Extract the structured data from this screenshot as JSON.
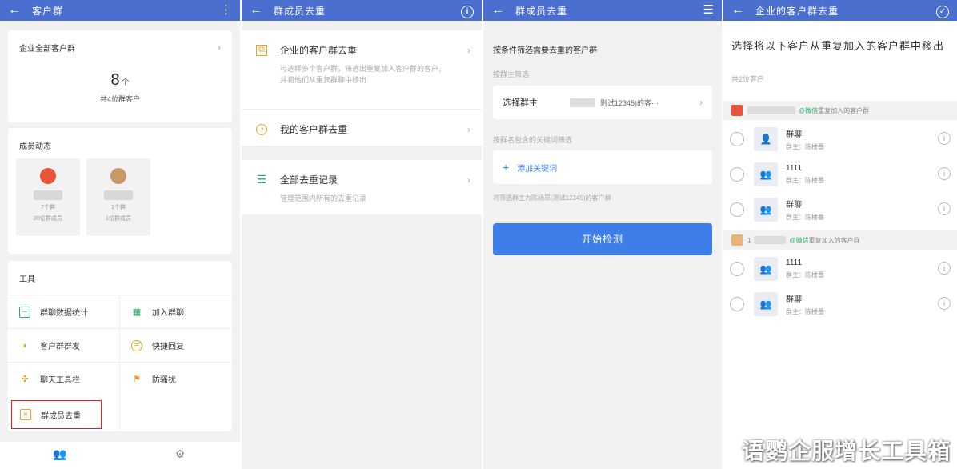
{
  "panel1": {
    "title": "客户群",
    "menu_icon": "more-vertical-icon",
    "all_groups": {
      "label": "企业全部客户群",
      "count": "8",
      "unit": "个",
      "subtitle": "共4位群客户"
    },
    "members": {
      "title": "成员动态",
      "items": [
        {
          "line1": "7个群",
          "line2": "20位群成员"
        },
        {
          "line1": "1个群",
          "line2": "1位群成员"
        }
      ]
    },
    "tools": {
      "title": "工具",
      "items": [
        {
          "label": "群聊数据统计",
          "icon": "chart-icon",
          "color": "#2aae67"
        },
        {
          "label": "加入群聊",
          "icon": "qrcode-icon",
          "color": "#2aae67"
        },
        {
          "label": "客户群群发",
          "icon": "broadcast-icon",
          "color": "#f0a020"
        },
        {
          "label": "快捷回复",
          "icon": "chat-icon",
          "color": "#f0a020"
        },
        {
          "label": "聊天工具栏",
          "icon": "toolbar-icon",
          "color": "#f0a020"
        },
        {
          "label": "防骚扰",
          "icon": "flag-icon",
          "color": "#f0a020"
        },
        {
          "label": "群成员去重",
          "icon": "dedupe-icon",
          "color": "#f0a020"
        }
      ]
    }
  },
  "panel2": {
    "title": "群成员去重",
    "entries": [
      {
        "title": "企业的客户群去重",
        "desc": "可选择多个客户群，筛选出重复加入客户群的客户，并将他们从重复群聊中移出",
        "icon": "group-dedupe-icon",
        "color": "#f0a020"
      },
      {
        "title": "我的客户群去重",
        "desc": "",
        "icon": "my-group-icon",
        "color": "#f0a020"
      },
      {
        "title": "全部去重记录",
        "desc": "管理范围内所有的去重记录",
        "icon": "list-icon",
        "color": "#2aae67"
      }
    ]
  },
  "panel3": {
    "title": "群成员去重",
    "heading": "按条件筛选需要去重的客户群",
    "owner_filter_label": "按群主筛选",
    "owner_select_label": "选择群主",
    "owner_select_value": "则试12345)的客···",
    "keyword_filter_label": "按群名包含的关键词筛选",
    "add_keyword": "添加关键词",
    "hint": "将筛选群主为陈杨昂(测试12345)的客户群",
    "start_button": "开始检测"
  },
  "panel4": {
    "title": "企业的客户群去重",
    "headline": "选择将以下客户从重复加入的客户群中移出",
    "count": "共2位客户",
    "groups": [
      {
        "wechat": "@微信",
        "desc": "重复加入的客户群",
        "rows": [
          {
            "name": "群聊",
            "owner": "群主：陈楼番"
          },
          {
            "name": "1111",
            "owner": "群主：陈楼番"
          },
          {
            "name": "群聊",
            "owner": "群主：陈楼番"
          }
        ]
      },
      {
        "prefix": "1",
        "wechat": "@微信",
        "desc": "重复加入的客户群",
        "rows": [
          {
            "name": "1111",
            "owner": "群主：陈楼番"
          },
          {
            "name": "群聊",
            "owner": "群主：陈楼番"
          }
        ]
      }
    ]
  },
  "watermark": "语鹦企服增长工具箱"
}
